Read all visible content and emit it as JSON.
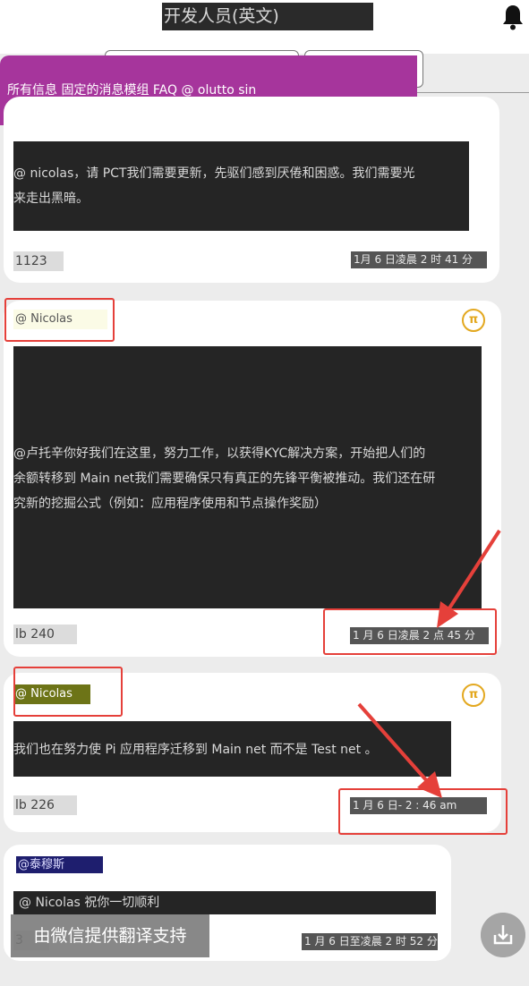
{
  "header": {
    "title": "开发人员(英文)",
    "bell_icon": "bell-icon"
  },
  "banner": {
    "text": "所有信息 固定的消息模组 FAQ @ olutto sin"
  },
  "messages": [
    {
      "body_lines": [
        "@ nicolas，请 PCT我们需要更新，先驱们感到厌倦和困惑。我们需要光",
        "来走出黑暗。"
      ],
      "count": "1123",
      "timestamp": "1月 6 日凌晨 2 时 41 分"
    },
    {
      "mention": "@ Nicolas",
      "body_lines": [
        "@卢托辛你好我们在这里，努力工作，以获得KYC解决方案，开始把人们的",
        "余额转移到 Main net我们需要确保只有真正的先锋平衡被推动。我们还在研",
        "究新的挖掘公式（例如：应用程序使用和节点操作奖励）"
      ],
      "count": "lb 240",
      "timestamp": "1 月 6 日凌晨 2 点 45 分"
    },
    {
      "mention": "@ Nicolas",
      "body_lines": [
        "我们也在努力使 Pi 应用程序迁移到 Main net 而不是 Test net 。"
      ],
      "count": "lb 226",
      "timestamp": "1 月 6 日- 2 : 46 am"
    },
    {
      "mention": "@泰穆斯",
      "body_lines": [
        "@ Nicolas 祝你一切顺利"
      ],
      "count": "3",
      "timestamp": "1 月 6 日至凌晨 2 时 52 分"
    }
  ],
  "pi_symbol": "π",
  "overlay": {
    "text": "由微信提供翻译支持"
  },
  "colors": {
    "banner": "#a6359c",
    "highlight": "#e5403a",
    "pi_gold": "#e3a81f"
  }
}
